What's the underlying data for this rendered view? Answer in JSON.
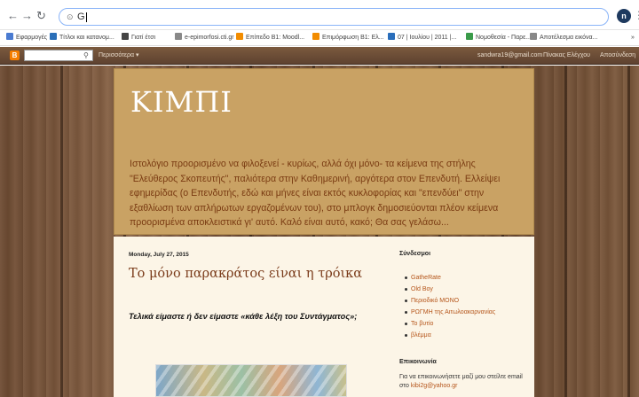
{
  "browser": {
    "address_text": "G",
    "profile_initial": "n",
    "bookmarks": [
      {
        "label": "Εφαρμογές",
        "icon": "apps-grid-icon",
        "color": "#4a7bd1"
      },
      {
        "label": "Τίτλοι και κατανομ...",
        "icon": "site-icon",
        "color": "#2b6fb8"
      },
      {
        "label": "Γιατί έτσι",
        "icon": "page-icon",
        "color": "#444444"
      },
      {
        "label": "e-epimorfosi.cti.gr",
        "icon": "document-icon",
        "color": "#888888"
      },
      {
        "label": "Επίπεδο Β1: Moodl...",
        "icon": "moodle-icon",
        "color": "#f28c00"
      },
      {
        "label": "Επιμόρφωση Β1: Ελ...",
        "icon": "moodle-icon",
        "color": "#f28c00"
      },
      {
        "label": "07 | Ιουλίου | 2011 |...",
        "icon": "wordpress-icon",
        "color": "#2a6ebb"
      },
      {
        "label": "Νομοθεσία - Παρε...",
        "icon": "figure-icon",
        "color": "#3a9b4a"
      },
      {
        "label": "Αποτέλεσμα εικόνα...",
        "icon": "document-icon",
        "color": "#888888"
      }
    ],
    "more_bookmarks": "»"
  },
  "navbar": {
    "more_label": "Περισσότερα ▾",
    "search_icon": "⚲",
    "email": "sandwra19@gmail.com",
    "dashboard": "Πίνακας Ελέγχου",
    "signout": "Αποσύνδεση"
  },
  "blog": {
    "title": "ΚΙΜΠΙ",
    "description": "Ιστολόγιο προορισμένο να φιλοξενεί - κυρίως, αλλά όχι μόνο- τα κείμενα της στήλης \"Ελεύθερος Σκοπευτής\", παλιότερα στην Καθημερινή, αργότερα στον Επενδυτή. Ελλείψει εφημερίδας (ο Επενδυτής, εδώ και μήνες είναι εκτός κυκλοφορίας και \"επενδύει\" στην εξαθλίωση των απλήρωτων εργαζομένων του), στο μπλογκ δημοσιεύονται πλέον κείμενα προορισμένα αποκλειστικά γι' αυτό. Καλό είναι αυτό, κακό; Θα σας γελάσω..."
  },
  "post": {
    "date": "Monday, July 27, 2015",
    "title": "Το μόνο παρακράτος είναι η τρόικα",
    "subtitle": "Τελικά είμαστε ή δεν είμαστε «κάθε λέξη του Συντάγματος»;"
  },
  "sidebar": {
    "links_title": "Σύνδεσμοι",
    "links": [
      "GatheRate",
      "Old Boy",
      "Περιοδικό ΜΟΝΟ",
      "ΡΩΓΜΗ της Αιτωλοακαρνανίας",
      "Το βυτίο",
      "βλέμμα"
    ],
    "contact_title": "Επικοινωνία",
    "contact_text": "Για να επικοινωνήσετε μαζί μου στείλτε email στο",
    "contact_email": "kibi2g@yahoo.gr"
  },
  "colors": {
    "header_bg": "#c9a264",
    "title_color": "#ffffff",
    "description_color": "#7a3b12",
    "content_bg": "#fcf5e7",
    "link_color": "#b5551a",
    "post_title_color": "#7a3b1a"
  }
}
